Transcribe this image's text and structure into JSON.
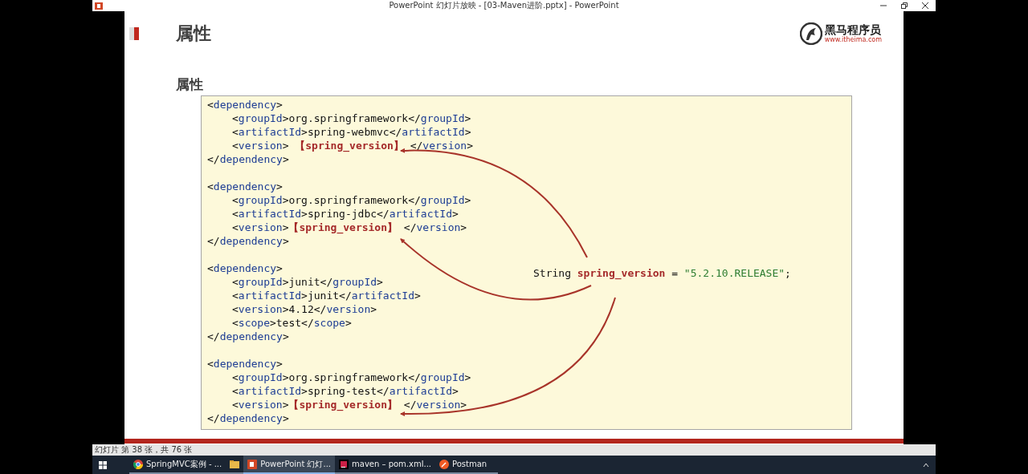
{
  "window": {
    "title": "PowerPoint 幻灯片放映 - [03-Maven进阶.pptx] - PowerPoint"
  },
  "slide": {
    "title": "属性",
    "subtitle": "属性",
    "logo": {
      "name": "黑马程序员",
      "url": "www.itheima.com"
    },
    "dependencies": [
      {
        "open": [
          {
            "kind": "punct",
            "text": "<"
          },
          {
            "kind": "tag",
            "text": "dependency"
          },
          {
            "kind": "punct",
            "text": ">"
          }
        ],
        "children": [
          [
            {
              "kind": "punct",
              "text": "<"
            },
            {
              "kind": "tag",
              "text": "groupId"
            },
            {
              "kind": "punct",
              "text": ">org.springframework</"
            },
            {
              "kind": "tag",
              "text": "groupId"
            },
            {
              "kind": "punct",
              "text": ">"
            }
          ],
          [
            {
              "kind": "punct",
              "text": "<"
            },
            {
              "kind": "tag",
              "text": "artifactId"
            },
            {
              "kind": "punct",
              "text": ">spring-webmvc</"
            },
            {
              "kind": "tag",
              "text": "artifactId"
            },
            {
              "kind": "punct",
              "text": ">"
            }
          ],
          [
            {
              "kind": "punct",
              "text": "<"
            },
            {
              "kind": "tag",
              "text": "version"
            },
            {
              "kind": "punct",
              "text": "> "
            },
            {
              "kind": "placeholder",
              "text": "【spring_version】"
            },
            {
              "kind": "punct",
              "text": " </"
            },
            {
              "kind": "tag",
              "text": "version"
            },
            {
              "kind": "punct",
              "text": ">"
            }
          ]
        ],
        "close": [
          {
            "kind": "punct",
            "text": "</"
          },
          {
            "kind": "tag",
            "text": "dependency"
          },
          {
            "kind": "punct",
            "text": ">"
          }
        ]
      },
      {
        "open": [
          {
            "kind": "punct",
            "text": "<"
          },
          {
            "kind": "tag",
            "text": "dependency"
          },
          {
            "kind": "punct",
            "text": ">"
          }
        ],
        "children": [
          [
            {
              "kind": "punct",
              "text": "<"
            },
            {
              "kind": "tag",
              "text": "groupId"
            },
            {
              "kind": "punct",
              "text": ">org.springframework</"
            },
            {
              "kind": "tag",
              "text": "groupId"
            },
            {
              "kind": "punct",
              "text": ">"
            }
          ],
          [
            {
              "kind": "punct",
              "text": "<"
            },
            {
              "kind": "tag",
              "text": "artifactId"
            },
            {
              "kind": "punct",
              "text": ">spring-jdbc</"
            },
            {
              "kind": "tag",
              "text": "artifactId"
            },
            {
              "kind": "punct",
              "text": ">"
            }
          ],
          [
            {
              "kind": "punct",
              "text": "<"
            },
            {
              "kind": "tag",
              "text": "version"
            },
            {
              "kind": "punct",
              "text": ">"
            },
            {
              "kind": "placeholder",
              "text": "【spring_version】"
            },
            {
              "kind": "punct",
              "text": " </"
            },
            {
              "kind": "tag",
              "text": "version"
            },
            {
              "kind": "punct",
              "text": ">"
            }
          ]
        ],
        "close": [
          {
            "kind": "punct",
            "text": "</"
          },
          {
            "kind": "tag",
            "text": "dependency"
          },
          {
            "kind": "punct",
            "text": ">"
          }
        ]
      },
      {
        "open": [
          {
            "kind": "punct",
            "text": "<"
          },
          {
            "kind": "tag",
            "text": "dependency"
          },
          {
            "kind": "punct",
            "text": ">"
          }
        ],
        "children": [
          [
            {
              "kind": "punct",
              "text": "<"
            },
            {
              "kind": "tag",
              "text": "groupId"
            },
            {
              "kind": "punct",
              "text": ">junit</"
            },
            {
              "kind": "tag",
              "text": "groupId"
            },
            {
              "kind": "punct",
              "text": ">"
            }
          ],
          [
            {
              "kind": "punct",
              "text": "<"
            },
            {
              "kind": "tag",
              "text": "artifactId"
            },
            {
              "kind": "punct",
              "text": ">junit</"
            },
            {
              "kind": "tag",
              "text": "artifactId"
            },
            {
              "kind": "punct",
              "text": ">"
            }
          ],
          [
            {
              "kind": "punct",
              "text": "<"
            },
            {
              "kind": "tag",
              "text": "version"
            },
            {
              "kind": "punct",
              "text": ">4.12</"
            },
            {
              "kind": "tag",
              "text": "version"
            },
            {
              "kind": "punct",
              "text": ">"
            }
          ],
          [
            {
              "kind": "punct",
              "text": "<"
            },
            {
              "kind": "tag",
              "text": "scope"
            },
            {
              "kind": "punct",
              "text": ">test</"
            },
            {
              "kind": "tag",
              "text": "scope"
            },
            {
              "kind": "punct",
              "text": ">"
            }
          ]
        ],
        "close": [
          {
            "kind": "punct",
            "text": "</"
          },
          {
            "kind": "tag",
            "text": "dependency"
          },
          {
            "kind": "punct",
            "text": ">"
          }
        ]
      },
      {
        "open": [
          {
            "kind": "punct",
            "text": "<"
          },
          {
            "kind": "tag",
            "text": "dependency"
          },
          {
            "kind": "punct",
            "text": ">"
          }
        ],
        "children": [
          [
            {
              "kind": "punct",
              "text": "<"
            },
            {
              "kind": "tag",
              "text": "groupId"
            },
            {
              "kind": "punct",
              "text": ">org.springframework</"
            },
            {
              "kind": "tag",
              "text": "groupId"
            },
            {
              "kind": "punct",
              "text": ">"
            }
          ],
          [
            {
              "kind": "punct",
              "text": "<"
            },
            {
              "kind": "tag",
              "text": "artifactId"
            },
            {
              "kind": "punct",
              "text": ">spring-test</"
            },
            {
              "kind": "tag",
              "text": "artifactId"
            },
            {
              "kind": "punct",
              "text": ">"
            }
          ],
          [
            {
              "kind": "punct",
              "text": "<"
            },
            {
              "kind": "tag",
              "text": "version"
            },
            {
              "kind": "punct",
              "text": ">"
            },
            {
              "kind": "placeholder",
              "text": "【spring_version】"
            },
            {
              "kind": "punct",
              "text": " </"
            },
            {
              "kind": "tag",
              "text": "version"
            },
            {
              "kind": "punct",
              "text": ">"
            }
          ]
        ],
        "close": [
          {
            "kind": "punct",
            "text": "</"
          },
          {
            "kind": "tag",
            "text": "dependency"
          },
          {
            "kind": "punct",
            "text": ">"
          }
        ]
      }
    ],
    "declaration": [
      {
        "kind": "punct",
        "text": "String "
      },
      {
        "kind": "variable",
        "text": "spring_version"
      },
      {
        "kind": "punct",
        "text": " = "
      },
      {
        "kind": "string",
        "text": "\"5.2.10.RELEASE\""
      },
      {
        "kind": "punct",
        "text": ";"
      }
    ]
  },
  "status_bar": {
    "text": "幻灯片 第 38 张，共 76 张"
  },
  "taskbar": {
    "items": [
      {
        "kind": "chrome",
        "label": "SpringMVC案例 - ...",
        "selected": false
      },
      {
        "kind": "explorer",
        "selected": false
      },
      {
        "kind": "powerpoint",
        "label": "PowerPoint 幻灯...",
        "selected": true
      },
      {
        "kind": "intellij",
        "label": "maven – pom.xml...",
        "selected": false
      },
      {
        "kind": "postman",
        "label": "Postman",
        "selected": false
      }
    ]
  }
}
